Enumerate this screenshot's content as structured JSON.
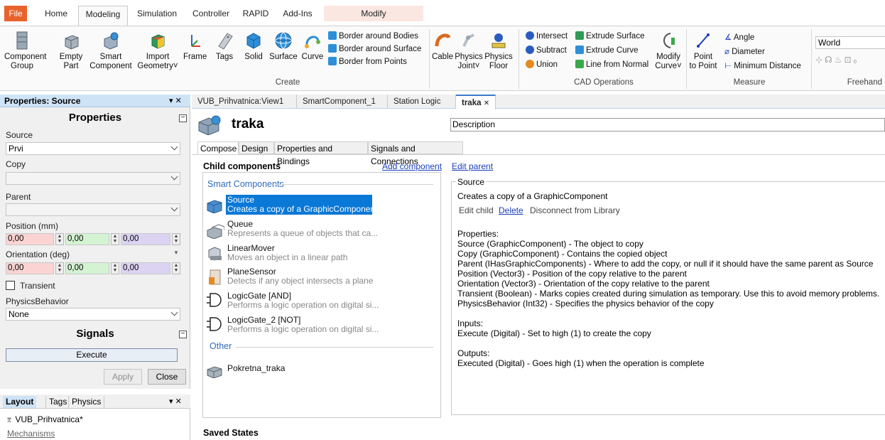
{
  "ribbon_tabs": [
    "File",
    "Home",
    "Modeling",
    "Simulation",
    "Controller",
    "RAPID",
    "Add-Ins",
    "Modify"
  ],
  "ribbon": {
    "component_group": [
      "Component",
      "Group"
    ],
    "empty_part": [
      "Empty",
      "Part"
    ],
    "smart_component": [
      "Smart",
      "Component"
    ],
    "import_geometry": [
      "Import",
      "Geometry"
    ],
    "frame": "Frame",
    "tags": "Tags",
    "solid": "Solid",
    "surface": "Surface",
    "curve": "Curve",
    "border_bodies": "Border around Bodies",
    "border_surface": "Border around Surface",
    "border_points": "Border from Points",
    "create_label": "Create",
    "cable": "Cable",
    "physics_joint": [
      "Physics",
      "Joint"
    ],
    "physics_floor": [
      "Physics",
      "Floor"
    ],
    "intersect": "Intersect",
    "subtract": "Subtract",
    "union": "Union",
    "extrude_surface": "Extrude Surface",
    "extrude_curve": "Extrude Curve",
    "line_from_normal": "Line from Normal",
    "modify_curve": [
      "Modify",
      "Curve"
    ],
    "cad_label": "CAD Operations",
    "point_to_point": [
      "Point",
      "to Point"
    ],
    "angle": "Angle",
    "diameter": "Diameter",
    "minimum_distance": "Minimum Distance",
    "measure_label": "Measure",
    "world_value": "World",
    "freehand_label": "Freehand"
  },
  "properties_panel": {
    "header": "Properties: Source",
    "pin": "▾ ✕",
    "properties_title": "Properties",
    "source_label": "Source",
    "source_value": "Prvi",
    "copy_label": "Copy",
    "copy_value": "",
    "parent_label": "Parent",
    "parent_value": "",
    "position_label": "Position (mm)",
    "position": [
      "0,00",
      "0,00",
      "0,00"
    ],
    "orientation_label": "Orientation (deg)",
    "orientation": [
      "0,00",
      "0,00",
      "0,00"
    ],
    "transient_label": "Transient",
    "physics_label": "PhysicsBehavior",
    "physics_value": "None",
    "signals_title": "Signals",
    "execute": "Execute",
    "apply": "Apply",
    "close": "Close"
  },
  "layout_panel": {
    "tabs": [
      "Layout",
      "Tags",
      "Physics"
    ],
    "station": "VUB_Prihvatnica*",
    "mechanisms": "Mechanisms"
  },
  "doc_tabs": [
    "VUB_Prihvatnica:View1",
    "SmartComponent_1",
    "Station Logic",
    "traka"
  ],
  "doc_tab_close": "✕",
  "main": {
    "title": "traka",
    "description_placeholder": "Description",
    "subtabs": [
      "Compose",
      "Design",
      "Properties and Bindings",
      "Signals and Connections"
    ],
    "child_components": "Child components",
    "add_component": "Add component",
    "edit_parent": "Edit parent",
    "smart_components_label": "Smart Components",
    "other_label": "Other",
    "items": [
      {
        "name": "Source",
        "desc": "Creates a copy of a GraphicComponent"
      },
      {
        "name": "Queue",
        "desc": "Represents a queue of objects that ca..."
      },
      {
        "name": "LinearMover",
        "desc": "Moves an object in a linear path"
      },
      {
        "name": "PlaneSensor",
        "desc": "Detects if any object intersects a plane"
      },
      {
        "name": "LogicGate [AND]",
        "desc": "Performs a logic operation on digital si..."
      },
      {
        "name": "LogicGate_2 [NOT]",
        "desc": "Performs a logic operation on digital si..."
      }
    ],
    "other_item": "Pokretna_traka",
    "saved_states": "Saved States",
    "detail": {
      "group_label": "Source",
      "summary": "Creates a copy of a GraphicComponent",
      "edit_child": "Edit child",
      "delete": "Delete",
      "disconnect": "Disconnect from Library",
      "properties_header": "Properties:",
      "properties": [
        "Source (GraphicComponent) - The object to copy",
        "Copy (GraphicComponent) - Contains the copied object",
        "Parent (IHasGraphicComponents) - Where to add the copy, or null if it should have the same parent as Source",
        "Position (Vector3) - Position of the copy relative to the parent",
        "Orientation (Vector3) - Orientation of the copy relative to the parent",
        "Transient (Boolean) - Marks copies created during simulation as temporary. Use this to avoid memory problems.",
        "PhysicsBehavior (Int32) - Specifies the physics behavior of the copy"
      ],
      "inputs_header": "Inputs:",
      "inputs": "Execute (Digital) - Set to high (1) to create the copy",
      "outputs_header": "Outputs:",
      "outputs": "Executed (Digital) - Goes high (1) when the operation is complete"
    }
  }
}
